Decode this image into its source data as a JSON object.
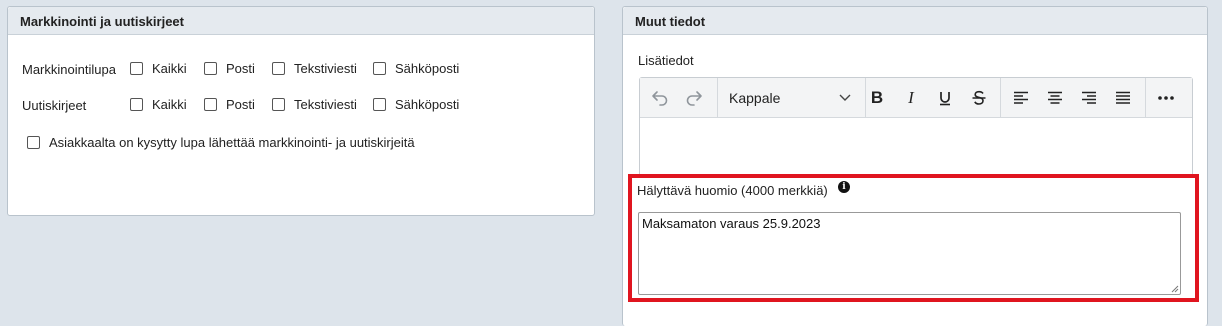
{
  "left_panel": {
    "title": "Markkinointi ja uutiskirjeet",
    "rows": [
      {
        "label": "Markkinointilupa",
        "options": [
          "Kaikki",
          "Posti",
          "Tekstiviesti",
          "Sähköposti"
        ]
      },
      {
        "label": "Uutiskirjeet",
        "options": [
          "Kaikki",
          "Posti",
          "Tekstiviesti",
          "Sähköposti"
        ]
      }
    ],
    "consent_label": "Asiakkaalta on kysytty lupa lähettää markkinointi- ja uutiskirjeitä"
  },
  "right_panel": {
    "title": "Muut tiedot",
    "additional_info_label": "Lisätiedot",
    "editor": {
      "block_format": "Kappale",
      "toolbar_icons": [
        "undo-icon",
        "redo-icon",
        "bold-icon",
        "italic-icon",
        "underline-icon",
        "strikethrough-icon",
        "align-left-icon",
        "align-center-icon",
        "align-right-icon",
        "align-justify-icon",
        "more-icon"
      ],
      "content": ""
    },
    "alert_note": {
      "label": "Hälyttävä huomio (4000 merkkiä)",
      "info_icon": "i",
      "value": "Maksamaton varaus 25.9.2023"
    }
  },
  "colors": {
    "page_bg": "#dde4eb",
    "panel_header_bg": "#e5eaef",
    "highlight_border": "#e0151f"
  }
}
